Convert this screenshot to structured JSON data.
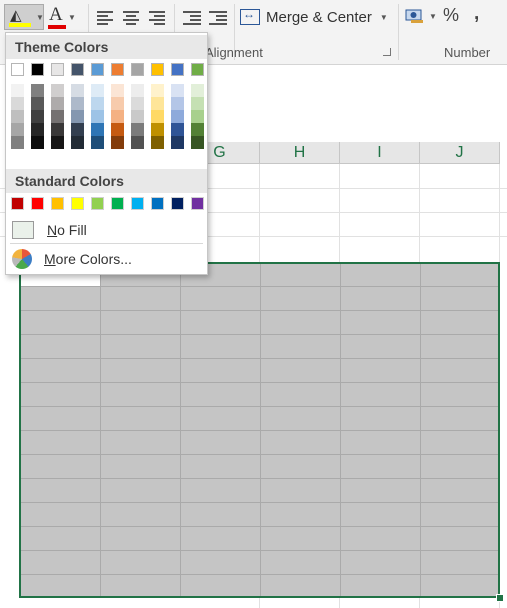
{
  "ribbon": {
    "groups": {
      "alignment": "Alignment",
      "number": "Number"
    },
    "merge_center_label": "Merge & Center",
    "percent_label": "%",
    "comma_label": ","
  },
  "columns": [
    "G",
    "H",
    "I",
    "J"
  ],
  "palette": {
    "theme_heading": "Theme Colors",
    "standard_heading": "Standard Colors",
    "no_fill_label": "No Fill",
    "more_colors_label": "More Colors...",
    "selected_fill_color": "#ffff00",
    "selected_font_color": "#e00000",
    "theme_colors": [
      "#ffffff",
      "#000000",
      "#e7e6e6",
      "#44546a",
      "#5b9bd5",
      "#ed7d31",
      "#a5a5a5",
      "#ffc000",
      "#4472c4",
      "#70ad47"
    ],
    "theme_shades": [
      [
        "#f2f2f2",
        "#d9d9d9",
        "#bfbfbf",
        "#a6a6a6",
        "#808080"
      ],
      [
        "#808080",
        "#595959",
        "#404040",
        "#262626",
        "#0d0d0d"
      ],
      [
        "#d0cece",
        "#aeabab",
        "#757171",
        "#3a3838",
        "#171616"
      ],
      [
        "#d6dce4",
        "#adb9ca",
        "#8497b0",
        "#333f50",
        "#222b35"
      ],
      [
        "#deebf6",
        "#bdd7ee",
        "#9dc3e6",
        "#2e75b5",
        "#1e4e79"
      ],
      [
        "#fbe5d5",
        "#f7cbac",
        "#f4b183",
        "#c55a11",
        "#833c0b"
      ],
      [
        "#ededed",
        "#dbdbdb",
        "#c9c9c9",
        "#7b7b7b",
        "#525252"
      ],
      [
        "#fff2cc",
        "#fee599",
        "#ffd965",
        "#bf9000",
        "#7f6000"
      ],
      [
        "#d9e2f3",
        "#b4c6e7",
        "#8eaadb",
        "#2f5496",
        "#1f3864"
      ],
      [
        "#e2efd9",
        "#c5e0b3",
        "#a8d08d",
        "#538135",
        "#375623"
      ]
    ],
    "standard_colors": [
      "#c00000",
      "#ff0000",
      "#ffc000",
      "#ffff00",
      "#92d050",
      "#00b050",
      "#00b0f0",
      "#0070c0",
      "#002060",
      "#7030a0"
    ]
  }
}
